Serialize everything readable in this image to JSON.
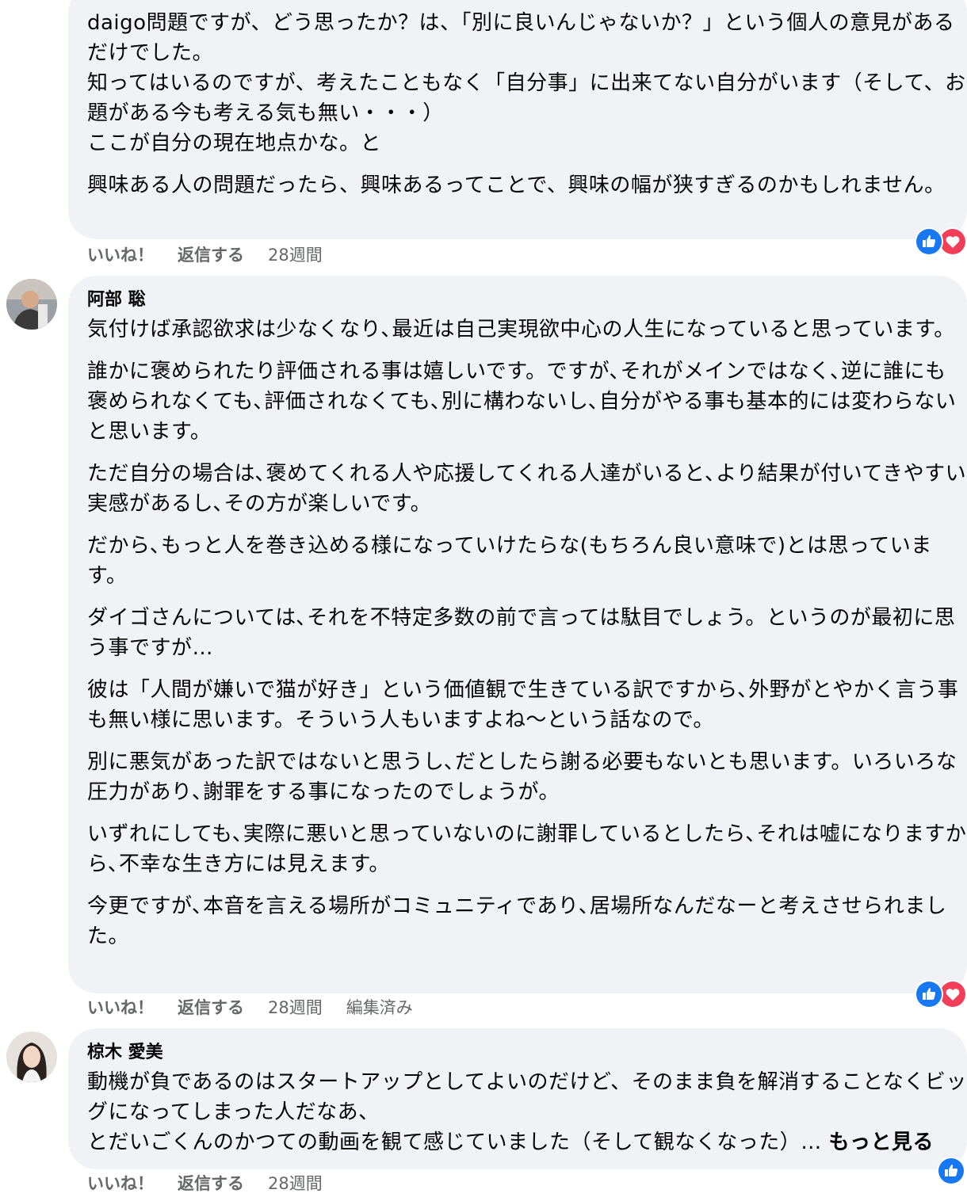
{
  "comments": [
    {
      "author": "",
      "paragraphs": [
        "daigo問題ですが、どう思ったか？は、「別に良いんじゃないか？」という個人の意見があるだけでした。\n知ってはいるのですが、考えたこともなく「自分事」に出来てない自分がいます（そして、お題がある今も考える気も無い・・・）\nここが自分の現在地点かな。と",
        "興味ある人の問題だったら、興味あるってことで、興味の幅が狭すぎるのかもしれません。"
      ],
      "actions": {
        "like": "いいね！",
        "reply": "返信する",
        "time": "28週間"
      },
      "reactions": [
        "like-reaction-icon",
        "love-reaction-icon"
      ]
    },
    {
      "author": "阿部 聡",
      "paragraphs": [
        "気付けば承認欲求は少なくなり､最近は自己実現欲中心の人生になっていると思っています。",
        "誰かに褒められたり評価される事は嬉しいです。ですが､それがメインではなく､逆に誰にも褒められなくても､評価されなくても､別に構わないし､自分がやる事も基本的には変わらないと思います。",
        "ただ自分の場合は､褒めてくれる人や応援してくれる人達がいると､より結果が付いてきやすい実感があるし､その方が楽しいです。",
        "だから､もっと人を巻き込める様になっていけたらな(もちろん良い意味で)とは思っています。",
        "ダイゴさんについては､それを不特定多数の前で言っては駄目でしょう。というのが最初に思う事ですが…",
        "彼は「人間が嫌いで猫が好き」という価値観で生きている訳ですから､外野がとやかく言う事も無い様に思います。そういう人もいますよね〜という話なので。",
        "別に悪気があった訳ではないと思うし､だとしたら謝る必要もないとも思います。いろいろな圧力があり､謝罪をする事になったのでしょうが。",
        "いずれにしても､実際に悪いと思っていないのに謝罪しているとしたら､それは嘘になりますから､不幸な生き方には見えます。",
        "今更ですが､本音を言える場所がコミュニティであり､居場所なんだなーと考えさせられました。"
      ],
      "actions": {
        "like": "いいね！",
        "reply": "返信する",
        "time": "28週間",
        "edited": "編集済み"
      },
      "reactions": [
        "like-reaction-icon",
        "love-reaction-icon"
      ]
    },
    {
      "author": "椋木 愛美",
      "paragraphs": [
        "動機が負であるのはスタートアップとしてよいのだけど、そのまま負を解消することなくビッグになってしまった人だなあ、\nとだいごくんのかつての動画を観て感じていました（そして観なくなった）… "
      ],
      "see_more": "もっと見る",
      "actions": {
        "like": "いいね！",
        "reply": "返信する",
        "time": "28週間"
      },
      "reactions": [
        "like-reaction-icon"
      ]
    }
  ],
  "colors": {
    "bubble": "#f0f2f5",
    "meta_text": "#65676b",
    "like_blue": "#1877f2",
    "love_red": "#f33e58"
  }
}
